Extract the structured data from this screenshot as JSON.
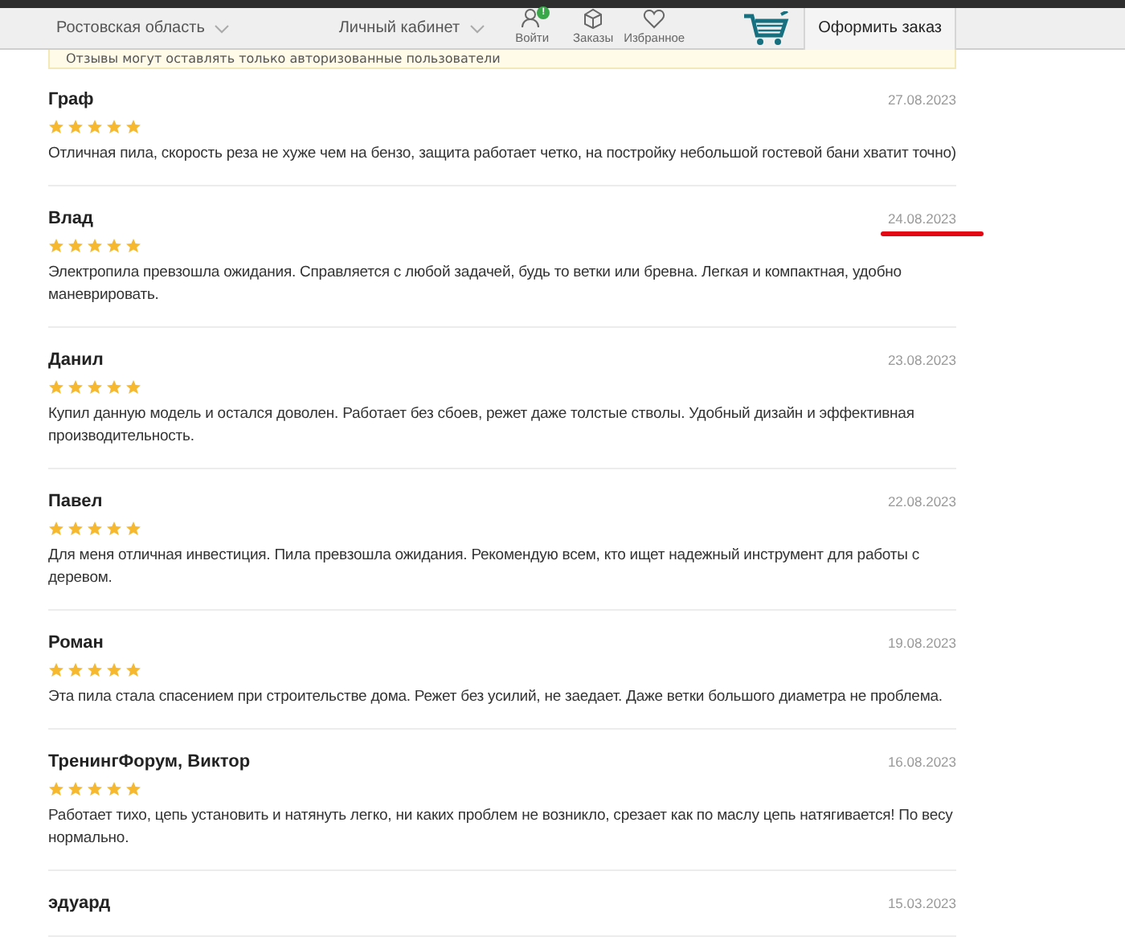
{
  "header": {
    "region": "Ростовская область",
    "account": "Личный кабинет",
    "nav": [
      {
        "kind": "login",
        "label": "Войти",
        "badge": "!"
      },
      {
        "kind": "orders",
        "label": "Заказы"
      },
      {
        "kind": "favorites",
        "label": "Избранное"
      }
    ],
    "checkout": "Оформить заказ"
  },
  "notice": "Отзывы могут оставлять только авторизованные пользователи",
  "reviews": [
    {
      "author": "Граф",
      "date": "27.08.2023",
      "stars": 5,
      "underlined": false,
      "text": "Отличная пила, скорость реза не хуже чем на бензо, защита работает четко, на постройку небольшой гостевой бани хватит точно)"
    },
    {
      "author": "Влад",
      "date": "24.08.2023",
      "stars": 5,
      "underlined": true,
      "text": "Электропила превзошла ожидания. Справляется с любой задачей, будь то ветки или бревна. Легкая и компактная, удобно маневрировать."
    },
    {
      "author": "Данил",
      "date": "23.08.2023",
      "stars": 5,
      "underlined": false,
      "text": "Купил данную модель и остался доволен. Работает без сбоев, режет даже толстые стволы. Удобный дизайн и эффективная производительность."
    },
    {
      "author": "Павел",
      "date": "22.08.2023",
      "stars": 5,
      "underlined": false,
      "text": "Для меня отличная инвестиция. Пила превзошла ожидания. Рекомендую всем, кто ищет надежный инструмент для работы с деревом."
    },
    {
      "author": "Роман",
      "date": "19.08.2023",
      "stars": 5,
      "underlined": false,
      "text": "Эта пила стала спасением при строительстве дома. Режет без усилий, не заедает. Даже ветки большого диаметра не проблема."
    },
    {
      "author": "ТренингФорум, Виктор",
      "date": "16.08.2023",
      "stars": 5,
      "underlined": false,
      "text": "Работает тихо, цепь установить и натянуть легко, ни каких проблем не возникло, срезает как по маслу цепь натягивается! По весу нормально."
    },
    {
      "author": "эдуард",
      "date": "15.03.2023",
      "underlined": false
    }
  ]
}
